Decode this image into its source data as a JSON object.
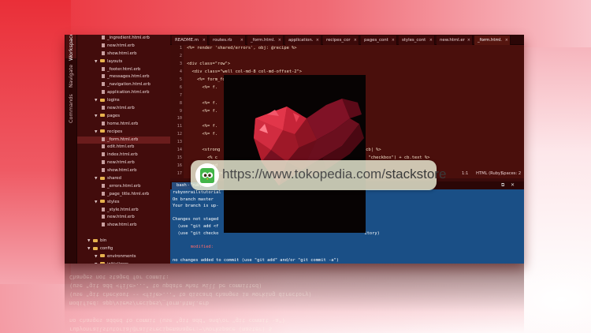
{
  "sidebar_tabs": [
    "Workspace",
    "Navigate",
    "Commands"
  ],
  "file_tree": [
    {
      "label": "_ingredient.html.erb",
      "kind": "file",
      "indent": 3
    },
    {
      "label": "new.html.erb",
      "kind": "file",
      "indent": 3
    },
    {
      "label": "show.html.erb",
      "kind": "file",
      "indent": 3
    },
    {
      "label": "layouts",
      "kind": "folder",
      "indent": 2
    },
    {
      "label": "_footer.html.erb",
      "kind": "file",
      "indent": 3
    },
    {
      "label": "_messages.html.erb",
      "kind": "file",
      "indent": 3
    },
    {
      "label": "_navigation.html.erb",
      "kind": "file",
      "indent": 3
    },
    {
      "label": "application.html.erb",
      "kind": "file",
      "indent": 3
    },
    {
      "label": "logins",
      "kind": "folder",
      "indent": 2
    },
    {
      "label": "new.html.erb",
      "kind": "file",
      "indent": 3
    },
    {
      "label": "pages",
      "kind": "folder",
      "indent": 2
    },
    {
      "label": "home.html.erb",
      "kind": "file",
      "indent": 3
    },
    {
      "label": "recipes",
      "kind": "folder",
      "indent": 2
    },
    {
      "label": "_form.html.erb",
      "kind": "file",
      "indent": 3,
      "selected": true
    },
    {
      "label": "edit.html.erb",
      "kind": "file",
      "indent": 3
    },
    {
      "label": "index.html.erb",
      "kind": "file",
      "indent": 3
    },
    {
      "label": "new.html.erb",
      "kind": "file",
      "indent": 3
    },
    {
      "label": "show.html.erb",
      "kind": "file",
      "indent": 3
    },
    {
      "label": "shared",
      "kind": "folder",
      "indent": 2
    },
    {
      "label": "_errors.html.erb",
      "kind": "file",
      "indent": 3
    },
    {
      "label": "_page_title.html.erb",
      "kind": "file",
      "indent": 3
    },
    {
      "label": "styles",
      "kind": "folder",
      "indent": 2
    },
    {
      "label": "_style.html.erb",
      "kind": "file",
      "indent": 3
    },
    {
      "label": "new.html.erb",
      "kind": "file",
      "indent": 3
    },
    {
      "label": "show.html.erb",
      "kind": "file",
      "indent": 3
    },
    {
      "label": "",
      "kind": "spacer",
      "indent": 0
    },
    {
      "label": "bin",
      "kind": "folder",
      "indent": 1
    },
    {
      "label": "config",
      "kind": "folder",
      "indent": 1
    },
    {
      "label": "environments",
      "kind": "folder",
      "indent": 2
    },
    {
      "label": "initializers",
      "kind": "folder",
      "indent": 2
    }
  ],
  "editor_tabs": [
    {
      "label": "README.m"
    },
    {
      "label": "routes.rb"
    },
    {
      "label": "_form.html."
    },
    {
      "label": "application."
    },
    {
      "label": "recipes_cor"
    },
    {
      "label": "pages_cont"
    },
    {
      "label": "styles_cont"
    },
    {
      "label": "new.html.er"
    },
    {
      "label": "_form.html.",
      "active": true
    }
  ],
  "line_numbers": [
    "1",
    "2",
    "3",
    "4",
    "5",
    "6",
    "7",
    "8",
    "9",
    "10",
    "11",
    "12",
    "13",
    "14",
    "15",
    "16",
    "17"
  ],
  "code_lines": [
    "<%= render 'shared/errors', obj: @recipe %>",
    "",
    "<div class=\"row\">",
    "  <div class=\"well col-md-8 col-md-offset-2\">",
    "    <%= form_for(@recipe, html: { multipart: true }) do |f| %>",
    "      <%= f.",
    "",
    "      <%= f.",
    "      <%= f.",
    "",
    "      <%= f.",
    "      <%= f.",
    "",
    "      <strong                                         .ids, :name do |cb| %>",
    "        <% c                                          check_box(class: \"checkbox\") + cb.text %>",
    "      <% end",
    "      <br><br>"
  ],
  "code_lines_tail": [
    "      <strong",
    "      <%= f.                                         .id, :name do |cb| %>",
    "                                                      \"checkbox\") %>"
  ],
  "status": {
    "position": "1:1",
    "mode": "HTML (Ruby)",
    "spaces": "Spaces: 2"
  },
  "terminal": {
    "tab_label": "bash - \"rubyonrai",
    "lines": [
      {
        "text": "rubyonrailstutorial",
        "style": "normal"
      },
      {
        "text": "On branch master",
        "style": "normal"
      },
      {
        "text": "Your branch is up-",
        "style": "normal"
      },
      {
        "text": "",
        "style": "normal"
      },
      {
        "text": "Changes not staged",
        "style": "normal"
      },
      {
        "text": "  (use \"git add <f",
        "style": "normal"
      },
      {
        "text": "  (use \"git checko                                                         itory)",
        "style": "normal"
      },
      {
        "text": "",
        "style": "normal"
      },
      {
        "text": "       modified:   ",
        "style": "red"
      },
      {
        "text": "",
        "style": "normal"
      },
      {
        "text": "no changes added to commit (use \"git add\" and/or \"git commit -a\")",
        "style": "normal"
      },
      {
        "text": "rubyonrailstutorial@railsrecipemanager:~/workspace (master) $ ",
        "style": "normal"
      }
    ]
  },
  "reflection_lines": [
    "rubyonrailstutorial@railsrecipemanager:~/workspace (master) $",
    "no changes added to commit (use \"git add\" and/or \"git commit -a\")",
    "",
    "modified:   app/views/recipes/_form.html.erb",
    "  (use \"git checkout -- <file>...\" to discard changes in working directory)",
    "  (use \"git add <file>...\" to update what will be committed)",
    "Changes not staged for commit:"
  ],
  "watermark": {
    "prefix": "https://www.tokopedia.com/",
    "highlight": "stackstore"
  },
  "colors": {
    "accent_red": "#ea2f38",
    "terminal_blue": "#1a4f86",
    "editor_bg": "#4a0f0c"
  }
}
